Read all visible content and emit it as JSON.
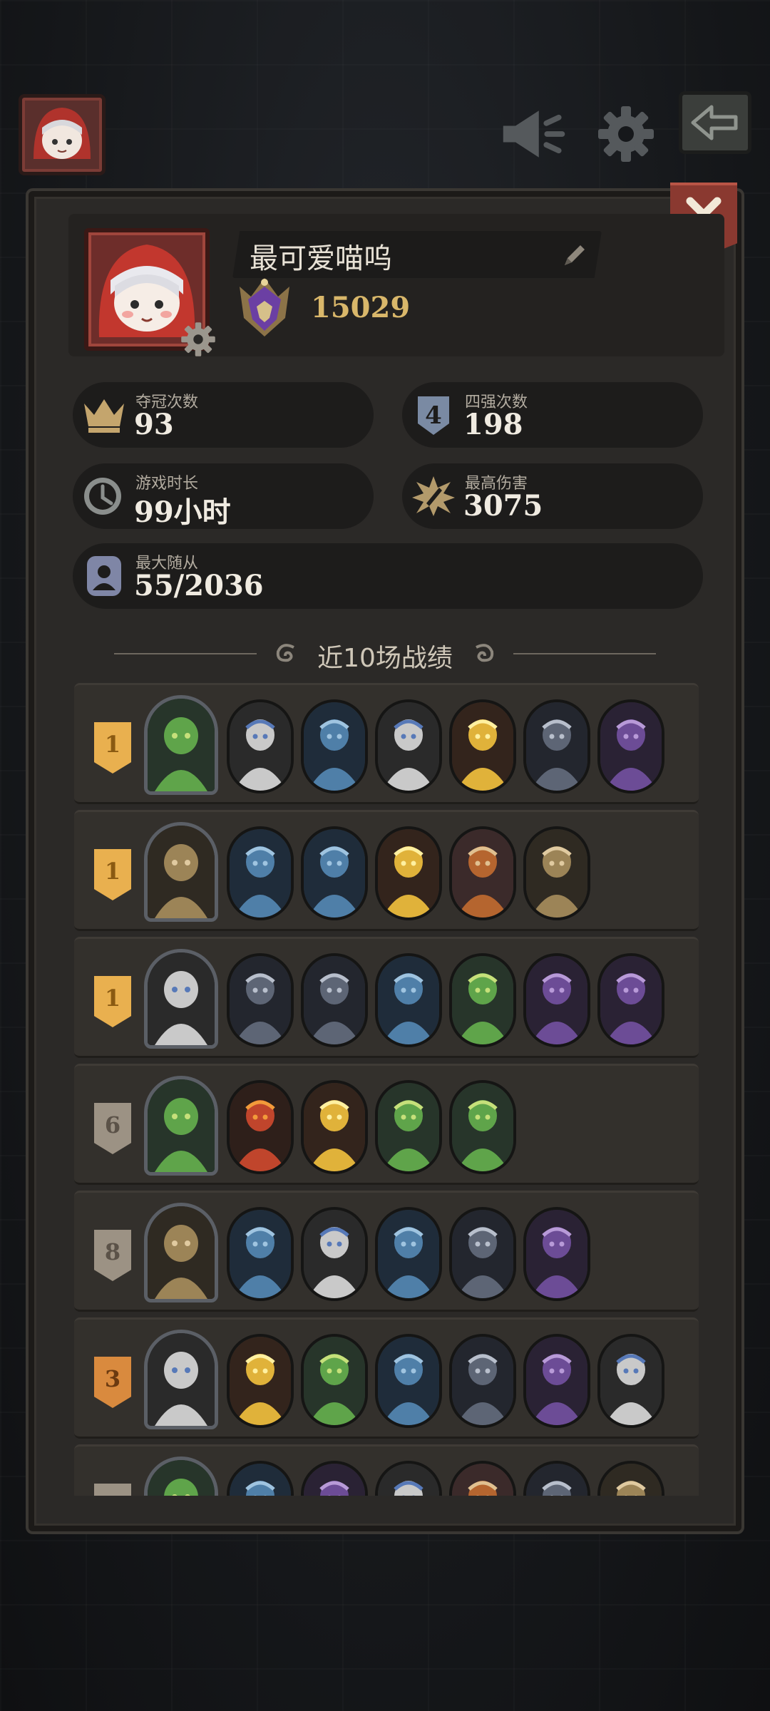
{
  "topbar": {
    "avatar_icon": "player-avatar-icon",
    "megaphone_icon": "megaphone-icon",
    "settings_icon": "gear-icon",
    "back_icon": "back-arrow-icon"
  },
  "profile": {
    "name": "最可爱喵呜",
    "rank_score": "15029",
    "avatar_icon": "red-hood-girl-avatar"
  },
  "stats": [
    {
      "label": "夺冠次数",
      "value": "93",
      "icon": "crown-icon"
    },
    {
      "label": "四强次数",
      "value": "198",
      "icon": "top4-shield-icon"
    },
    {
      "label": "游戏时长",
      "value": "99小时",
      "icon": "clock-icon"
    },
    {
      "label": "最高伤害",
      "value": "3075",
      "icon": "damage-burst-icon"
    },
    {
      "label": "最大随从",
      "value": "55/2036",
      "icon": "minion-portrait-icon"
    }
  ],
  "section": {
    "title": "近10场战绩"
  },
  "colors": {
    "gold_badge": "#e9b04f",
    "silver_badge": "#9c9284",
    "bronze_badge": "#d98a3e",
    "panel": "#2b2927",
    "accent_red": "#8a3930"
  },
  "matches": [
    {
      "place": "1",
      "hero": "hooded-wraith",
      "units": [
        "barbarian-archer",
        "green-goblin-shaman",
        "shadow-blade",
        "blue-lizard",
        "horned-beast",
        "purple-kraken"
      ]
    },
    {
      "place": "1",
      "hero": "blonde-knight",
      "units": [
        "black-shield-warrior",
        "white-rabbit-rogue",
        "steel-knight",
        "fire-dragon",
        "plumed-knight"
      ]
    },
    {
      "place": "1",
      "hero": "top-hat-ghoul",
      "units": [
        "white-rabbit-rogue",
        "skeleton-warrior",
        "treant",
        "fire-dragon",
        "plumed-knight",
        "armored-orc"
      ]
    },
    {
      "place": "6",
      "hero": "blue-slime-king",
      "units": [
        "red-assassin",
        "gold-paladin",
        "gold-paladin",
        "blue-siren"
      ]
    },
    {
      "place": "8",
      "hero": "bull-warlord",
      "units": [
        "blue-flame-spirit",
        "grey-eagle",
        "plumed-knight",
        "blue-siren",
        "rose-priest"
      ]
    },
    {
      "place": "3",
      "hero": "purple-bat",
      "units": [
        "red-assassin",
        "golden-flame",
        "golden-flame",
        "red-demon",
        "twin-hydra",
        "twin-hydra"
      ]
    },
    {
      "place": "",
      "hero": "red-mage",
      "units": [
        "unit-a",
        "unit-b",
        "unit-c",
        "unit-d",
        "unit-e",
        "unit-f"
      ]
    }
  ]
}
